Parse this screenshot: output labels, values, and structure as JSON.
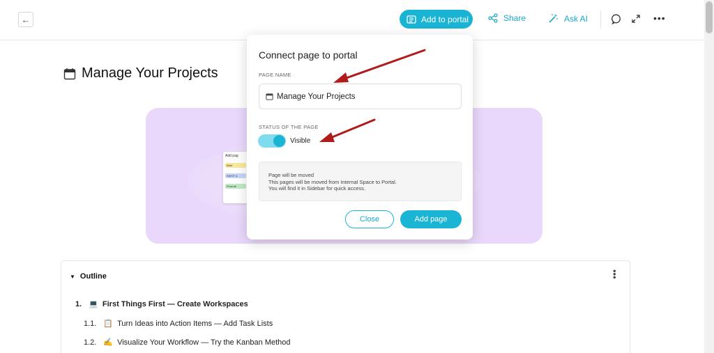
{
  "topbar": {
    "add_to_portal": "Add to portal",
    "share": "Share",
    "ask_ai": "Ask AI"
  },
  "page": {
    "title": "Manage Your Projects"
  },
  "cover": {
    "card_title": "Add pag",
    "tags": [
      {
        "label": "Brief",
        "color": "#fbe89a"
      },
      {
        "label": "SWOT A",
        "color": "#c9d6f7"
      },
      {
        "label": "Final de",
        "color": "#bfeac4"
      }
    ]
  },
  "outline": {
    "title": "Outline",
    "items": [
      {
        "num": "1.",
        "icon": "💻",
        "text": "First Things First — Create Workspaces"
      },
      {
        "num": "1.1.",
        "icon": "📋",
        "text": "Turn Ideas into Action Items — Add Task Lists"
      },
      {
        "num": "1.2.",
        "icon": "✍️",
        "text": "Visualize Your Workflow — Try the Kanban Method"
      }
    ]
  },
  "modal": {
    "title": "Connect page to portal",
    "page_name_label": "PAGE NAME",
    "page_name_value": "Manage Your Projects",
    "status_label": "STATUS OF THE PAGE",
    "status_value": "Visible",
    "status_on": true,
    "notice_line1": "Page will be moved",
    "notice_line2": "This pages will be moved from Internal Space to Portal.",
    "notice_line3": "You will find it in Sidebar for quick access.",
    "close_label": "Close",
    "add_label": "Add page"
  },
  "colors": {
    "accent": "#1ab4d4",
    "cover_bg": "#e9d8fb",
    "arrow": "#b01c1c"
  }
}
